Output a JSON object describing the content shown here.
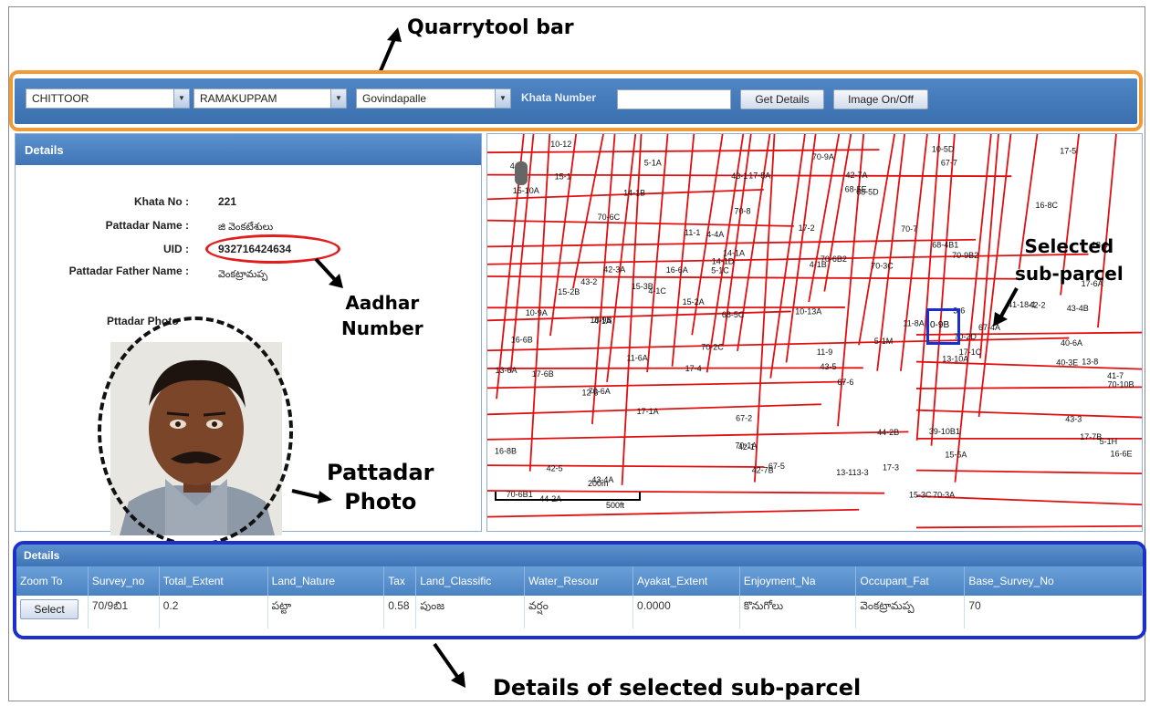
{
  "annotations": {
    "toolbar_title": "Quarrytool bar",
    "aadhar": "Aadhar\nNumber",
    "selected_subparcel": "Selected\nsub-parcel",
    "pattadar_photo": "Pattadar\nPhoto",
    "details_selected": "Details of selected sub-parcel"
  },
  "toolbar": {
    "district": "CHITTOOR",
    "mandal": "RAMAKUPPAM",
    "village": "Govindapalle",
    "khata_label": "Khata Number",
    "khata_value": "",
    "get_details": "Get Details",
    "image_toggle": "Image On/Off"
  },
  "details": {
    "header": "Details",
    "khata_no_label": "Khata No :",
    "khata_no": "221",
    "pattadar_name_label": "Pattadar Name :",
    "pattadar_name": "జి వెంకటేశులు",
    "uid_label": "UID :",
    "uid": "932716424634",
    "father_label": "Pattadar Father Name :",
    "father_name": "వెంకట్రామప్ప",
    "photo_label": "Pttadar Photo"
  },
  "map": {
    "parcels": [
      "39-10B1",
      "40-6A",
      "41-7",
      "41-18-1",
      "44-2A",
      "67-6",
      "67-2",
      "67-4A",
      "67-5",
      "67-7",
      "68-5C",
      "70-10B",
      "70-6A",
      "70-6C",
      "70-6B2",
      "70-6B1",
      "70-9A",
      "70-8",
      "70-7",
      "70-9B2",
      "40-3E",
      "42-1",
      "42-3A",
      "42-7B",
      "42-7A",
      "4-1A",
      "4-1C",
      "4-1B",
      "4-8",
      "3-6",
      "13-113-3",
      "15-2B",
      "15-3B",
      "15-10A",
      "15-5A",
      "16-6B",
      "16-6A",
      "17-1A",
      "17-2",
      "17-3",
      "17-6A",
      "17-7B",
      "17-8A",
      "14-1B",
      "13-10A",
      "13-9",
      "14-1D",
      "43-4A",
      "44-2B",
      "68-4B1",
      "68-5D",
      "70-3A",
      "70-3C",
      "70-2C",
      "68-5E",
      "70-1A",
      "70-2D",
      "43-5",
      "43-1",
      "43-2",
      "43-3",
      "43-4B",
      "42-2",
      "42-5",
      "4-4A",
      "5-1A",
      "5-1C",
      "5-1H",
      "5-1M",
      "10-9A",
      "10-9B",
      "11-1",
      "11-9",
      "11-6A",
      "11-8A",
      "10-12",
      "10-13A",
      "13-6A",
      "15-1",
      "15-2A",
      "15-3C",
      "16-8C",
      "16-8B",
      "16-6E",
      "17-1C",
      "17-5",
      "17-4",
      "17-6B",
      "14-1A",
      "13-8",
      "12-6",
      "10-5D"
    ],
    "selected": "0-9B",
    "scale": "200m",
    "scale2": "500ft"
  },
  "grid": {
    "header": "Details",
    "columns": [
      "Zoom To",
      "Survey_no",
      "Total_Extent",
      "Land_Nature",
      "Tax",
      "Land_Classific",
      "Water_Resour",
      "Ayakat_Extent",
      "Enjoyment_Na",
      "Occupant_Fat",
      "Base_Survey_No"
    ],
    "rows": [
      {
        "zoom": "Select",
        "survey_no": "70/9బి1",
        "total_extent": "0.2",
        "land_nature": "పట్టా",
        "tax": "0.58",
        "land_class": "పుంజ",
        "water": "వర్షం",
        "ayakat": "0.0000",
        "enjoyment": "కొనుగోలు",
        "occupant_father": "వెంకట్రామప్ప",
        "base_survey": "70"
      }
    ]
  }
}
